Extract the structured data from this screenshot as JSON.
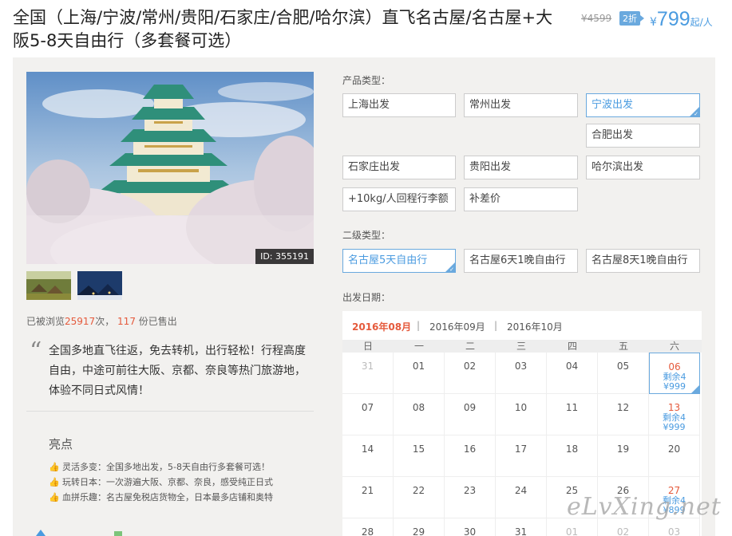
{
  "title": "全国（上海/宁波/常州/贵阳/石家庄/合肥/哈尔滨）直飞名古屋/名古屋+大阪5-8天自由行（多套餐可选）",
  "price": {
    "original": "¥4599",
    "discount": "2折",
    "symbol": "¥",
    "current": "799",
    "unit": "起/人"
  },
  "photo": {
    "id_label": "ID: 355191"
  },
  "stats": {
    "prefix": "已被浏览",
    "views": "25917",
    "mid": "次，",
    "sold": "117",
    "suffix": "份已售出"
  },
  "quote": {
    "mark": "“",
    "text": "全国多地直飞往返，免去转机，出行轻松！行程高度自由，中途可前往大阪、京都、奈良等热门旅游地，体验不同日式风情！"
  },
  "highlights": {
    "title": "亮点",
    "icon": "thumbs-up-icon",
    "items": [
      "灵活多变：全国多地出发，5-8天自由行多套餐可选！",
      "玩转日本：一次游遍大阪、京都、奈良，感受纯正日式",
      "血拼乐趣：名古屋免税店货物全，日本最多店铺和奥特"
    ]
  },
  "product_type": {
    "label": "产品类型：",
    "options": [
      "上海出发",
      "常州出发",
      "宁波出发",
      "合肥出发",
      "石家庄出发",
      "贵阳出发",
      "哈尔滨出发",
      "+10kg/人回程行李额",
      "补差价"
    ],
    "selected": "宁波出发"
  },
  "sub_type": {
    "label": "二级类型：",
    "options": [
      "名古屋5天自由行",
      "名古屋6天1晚自由行",
      "名古屋8天1晚自由行"
    ],
    "selected": "名古屋5天自由行"
  },
  "departure": {
    "label": "出发日期：",
    "months": [
      "2016年08月",
      "2016年09月",
      "2016年10月"
    ],
    "active_month": "2016年08月",
    "separator": "|",
    "weekdays": [
      "日",
      "一",
      "二",
      "三",
      "四",
      "五",
      "六"
    ],
    "weeks": [
      [
        {
          "d": "31",
          "m": true
        },
        {
          "d": "01"
        },
        {
          "d": "02"
        },
        {
          "d": "03"
        },
        {
          "d": "04"
        },
        {
          "d": "05"
        },
        {
          "d": "06",
          "rem": "剩余4",
          "price": "¥999",
          "sel": true
        }
      ],
      [
        {
          "d": "07"
        },
        {
          "d": "08"
        },
        {
          "d": "09"
        },
        {
          "d": "10"
        },
        {
          "d": "11"
        },
        {
          "d": "12"
        },
        {
          "d": "13",
          "rem": "剩余4",
          "price": "¥999"
        }
      ],
      [
        {
          "d": "14"
        },
        {
          "d": "15"
        },
        {
          "d": "16"
        },
        {
          "d": "17"
        },
        {
          "d": "18"
        },
        {
          "d": "19"
        },
        {
          "d": "20"
        }
      ],
      [
        {
          "d": "21"
        },
        {
          "d": "22"
        },
        {
          "d": "23"
        },
        {
          "d": "24"
        },
        {
          "d": "25"
        },
        {
          "d": "26"
        },
        {
          "d": "27",
          "rem": "剩余4",
          "price": "¥899"
        }
      ],
      [
        {
          "d": "28"
        },
        {
          "d": "29"
        },
        {
          "d": "30"
        },
        {
          "d": "31"
        },
        {
          "d": "01",
          "m": true
        },
        {
          "d": "02",
          "m": true
        },
        {
          "d": "03",
          "m": true
        }
      ]
    ]
  },
  "watermark": "eLvXing.net",
  "colors": {
    "accent": "#4a9be0",
    "highlight": "#e55a3c",
    "panel_bg": "#f2f1ef"
  }
}
